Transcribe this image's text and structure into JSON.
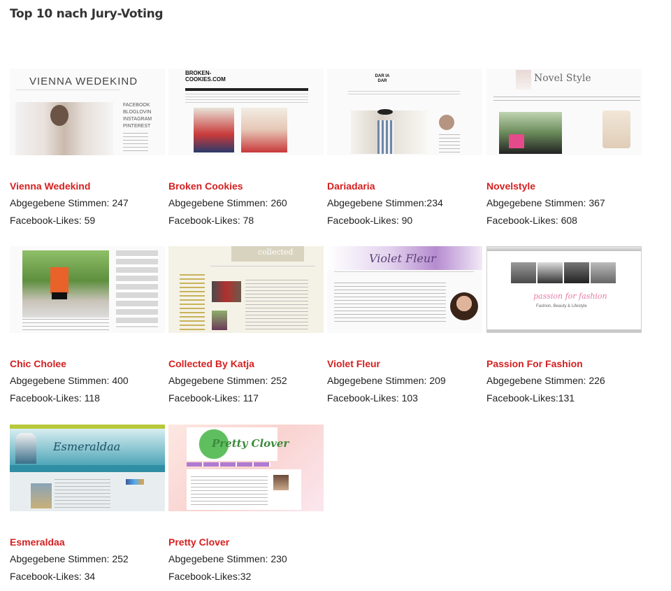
{
  "title": "Top 10 nach Jury-Voting",
  "labels": {
    "votes_prefix": "Abgegebene Stimmen:",
    "likes_prefix": "Facebook-Likes:"
  },
  "blogs": [
    {
      "name": "Vienna Wedekind",
      "votes_text": "Abgegebene Stimmen: 247",
      "likes_text": "Facebook-Likes: 59",
      "thumb_text": "VIENNA WEDEKIND",
      "menu": [
        "FACEBOOK",
        "BLOGLOVIN",
        "INSTAGRAM",
        "PINTEREST"
      ]
    },
    {
      "name": "Broken Cookies",
      "votes_text": "Abgegebene Stimmen: 260",
      "likes_text": "Facebook-Likes: 78",
      "thumb_text": "BROKEN-COOKIES.COM"
    },
    {
      "name": "Dariadaria",
      "votes_text": "Abgegebene Stimmen:234",
      "likes_text": "Facebook-Likes: 90",
      "thumb_text": "DAR IA DAR"
    },
    {
      "name": "Novelstyle",
      "votes_text": "Abgegebene Stimmen: 367",
      "likes_text": "Facebook-Likes: 608",
      "thumb_text": "Novel Style"
    },
    {
      "name": "Chic Cholee",
      "votes_text": "Abgegebene Stimmen: 400",
      "likes_text": "Facebook-Likes: 118"
    },
    {
      "name": "Collected By Katja",
      "votes_text": "Abgegebene Stimmen: 252",
      "likes_text": "Facebook-Likes: 117",
      "thumb_text": "collected"
    },
    {
      "name": "Violet Fleur",
      "votes_text": "Abgegebene Stimmen: 209",
      "likes_text": "Facebook-Likes: 103",
      "thumb_text": "Violet Fleur"
    },
    {
      "name": "Passion For Fashion",
      "votes_text": "Abgegebene Stimmen: 226",
      "likes_text": "Facebook-Likes:131",
      "thumb_text": "passion for fashion",
      "thumb_sub": "Fashion, Beauty & Lifestyle"
    },
    {
      "name": "Esmeraldaa",
      "votes_text": "Abgegebene Stimmen: 252",
      "likes_text": "Facebook-Likes: 34",
      "thumb_text": "Esmeraldaa"
    },
    {
      "name": "Pretty Clover",
      "votes_text": "Abgegebene Stimmen: 230",
      "likes_text": "Facebook-Likes:32",
      "thumb_text": "Pretty Clover"
    }
  ]
}
